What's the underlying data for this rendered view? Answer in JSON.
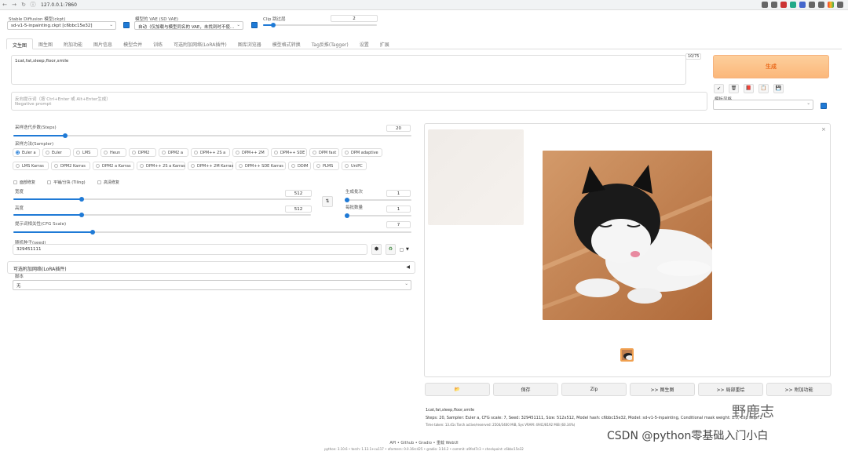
{
  "browser": {
    "url": "127.0.0.1:7860"
  },
  "top": {
    "sd_model_label": "Stable Diffusion 模型(ckpt)",
    "sd_model_value": "sd-v1-5-inpainting.ckpt [c6bbc15e32]",
    "vae_label": "模型的 VAE (SD VAE)",
    "vae_value": "自动（仅加载与模型同名的 VAE，未找到时不使...",
    "clip_label": "Clip 跳过层",
    "clip_value": "2"
  },
  "tabs": [
    "文生图",
    "图生图",
    "附加功能",
    "图片信息",
    "模型合并",
    "训练",
    "可选附加网络(LoRA插件)",
    "图库浏览器",
    "模型格式转换",
    "Tag反推(Tagger)",
    "设置",
    "扩展"
  ],
  "prompt": {
    "text": "1cat,fat,sleep,floor,smile",
    "counter": "10/75"
  },
  "negative": {
    "placeholder_line1": "反向提示词（按 Ctrl+Enter 或 Alt+Enter生成）",
    "placeholder_line2": "Negative prompt"
  },
  "generate_label": "生成",
  "tool_buttons": [
    "↙",
    "🗑",
    "📕",
    "📋",
    "💾"
  ],
  "style": {
    "label": "模板风格",
    "value": ""
  },
  "steps": {
    "label": "采样迭代步数(Steps)",
    "value": "20",
    "fraction": 0.13
  },
  "sampler": {
    "label": "采样方法(Sampler)",
    "row1": [
      "Euler a",
      "Euler",
      "LMS",
      "Heun",
      "DPM2",
      "DPM2 a",
      "DPM++ 2S a",
      "DPM++ 2M",
      "DPM++ SDE",
      "DPM fast",
      "DPM adaptive"
    ],
    "row2": [
      "LMS Karras",
      "DPM2 Karras",
      "DPM2 a Karras",
      "DPM++ 2S a Karras",
      "DPM++ 2M Karras",
      "DPM++ SDE Karras",
      "DDIM",
      "PLMS",
      "UniPC"
    ],
    "selected": "Euler a"
  },
  "options": {
    "face": "面部修复",
    "tiling": "平铺/分块 (Tiling)",
    "hires": "高清修复"
  },
  "width": {
    "label": "宽度",
    "value": "512",
    "fraction": 0.23
  },
  "height": {
    "label": "高度",
    "value": "512",
    "fraction": 0.23
  },
  "batch_count": {
    "label": "生成批次",
    "value": "1",
    "fraction": 0.0
  },
  "batch_size": {
    "label": "每批数量",
    "value": "1",
    "fraction": 0.0
  },
  "cfg": {
    "label": "提示词相关性(CFG Scale)",
    "value": "7",
    "fraction": 0.2
  },
  "seed": {
    "label": "随机种子(seed)",
    "value": "329451111"
  },
  "lora": {
    "title": "可选附加网络(LoRA插件)",
    "script_label": "脚本",
    "script_value": "无"
  },
  "actions": [
    "📂",
    "保存",
    "Zip",
    ">> 图生图",
    ">> 局部重绘",
    ">> 附加功能"
  ],
  "result": {
    "line1": "1cat,fat,sleep,floor,smile",
    "line2": "Steps: 20, Sampler: Euler a, CFG scale: 7, Seed: 329451111, Size: 512x512, Model hash: c6bbc15e32, Model: sd-v1-5-inpainting, Conditional mask weight: 1.0, Clip skip: 2",
    "line3": "Time taken: 13.41s  Torch active/reserved: 2504/3400 MiB, Sys VRAM: 4941/8192 MiB (60.34%)"
  },
  "footer": {
    "links": "API  •  Github  •  Gradio  •  重载 WebUI",
    "versions": "python: 3.10.6  •  torch: 1.13.1+cu117  •  xformers: 0.0.16rc425  •  gradio: 3.16.2  •  commit: a9fed7c3  •  checkpoint: c6bbc15e32"
  },
  "watermark": {
    "wechat": "野鹿志",
    "csdn": "CSDN @python零基础入门小白"
  },
  "colors": {
    "accent": "#1f7ad6",
    "generate_bg": "#fbb77a",
    "generate_text": "#ea6a1c"
  }
}
